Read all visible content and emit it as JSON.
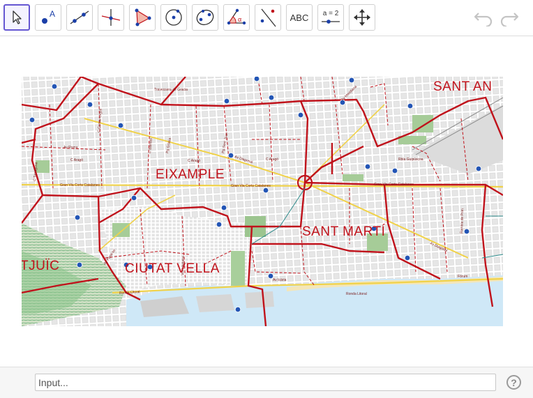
{
  "toolbar": {
    "tools": [
      {
        "id": "move",
        "icon": "cursor-arrow-icon",
        "active": true
      },
      {
        "id": "point",
        "icon": "point-icon",
        "label": "A"
      },
      {
        "id": "line",
        "icon": "line-icon"
      },
      {
        "id": "perpendicular",
        "icon": "perpendicular-line-icon"
      },
      {
        "id": "polygon",
        "icon": "polygon-icon"
      },
      {
        "id": "circle",
        "icon": "circle-center-icon"
      },
      {
        "id": "conic",
        "icon": "ellipse-icon"
      },
      {
        "id": "angle",
        "icon": "angle-icon",
        "label": "α"
      },
      {
        "id": "reflect",
        "icon": "reflect-about-line-icon"
      },
      {
        "id": "text",
        "icon": "text-icon",
        "label": "ABC"
      },
      {
        "id": "slider",
        "icon": "slider-icon",
        "label": "a = 2"
      },
      {
        "id": "move-view",
        "icon": "move-graphics-view-icon"
      }
    ],
    "undo_icon": "undo-icon",
    "redo_icon": "redo-icon"
  },
  "map": {
    "districts": {
      "eixample": "EIXAMPLE",
      "sant_marti": "SANT MARTÍ",
      "ciutat_vella": "CIUTAT VELLA",
      "sant_andreu_partial": "SANT AN",
      "montjuic_partial": "TJUÏC"
    },
    "streets": {
      "arago_1": "C Aragó",
      "arago_2": "C Aragó",
      "arago_3": "C Aragó",
      "gran_via_1": "Gran Via Corts Catalanes",
      "gran_via_2": "Gran Via Corts Catalanes",
      "gran_via_3": "Gran Via Corts Catalanes",
      "diagonal_1": "Av Diagonal",
      "diagonal_2": "Av Diagonal",
      "paral_lel": "Av Paral·lel",
      "via_laietana": "Via Laietana",
      "ronda_litoral_1": "Ronda Litoral",
      "ronda_litoral_2": "Ronda Litoral",
      "icaria": "Av Icària",
      "pg_gracia": "Pg Gràcia",
      "pg_sant_joan": "Pg Sant Joan",
      "meridiana": "Av Meridiana",
      "roma": "Av Roma",
      "guipuscoa": "Rbla Guipúscoa",
      "travessera": "Travessera de Gràcia",
      "forum": "Fòrum",
      "comte_urgell": "C Comte Urgell",
      "balmes": "C Balmes",
      "tarragona": "C Tarragona",
      "rambla_prim": "Rambla de Prim"
    }
  },
  "input": {
    "placeholder": "Input..."
  },
  "help": {
    "label": "?"
  },
  "colors": {
    "accent": "#6557d2",
    "boundary": "#c0121b",
    "park": "#7aa86e",
    "sea": "#cfe8f7",
    "block": "#e9e9e9"
  }
}
